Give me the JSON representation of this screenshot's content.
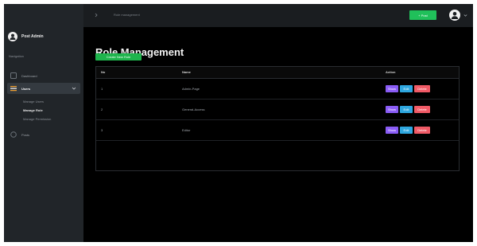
{
  "sidebar": {
    "brand_name": "Post Admin",
    "section_label": "Navigation",
    "items": [
      {
        "label": "Dashboard",
        "icon": "dashboard-icon"
      },
      {
        "label": "Users",
        "icon": "users-icon",
        "active": true
      },
      {
        "label": "Posts",
        "icon": "posts-icon"
      }
    ],
    "sub_items": [
      {
        "label": "Manage Users"
      },
      {
        "label": "Manage Role",
        "current": true
      },
      {
        "label": "Manage Permission"
      }
    ]
  },
  "topbar": {
    "breadcrumb": "Role management",
    "new_button": "+ Post"
  },
  "main": {
    "title": "Role Management",
    "create_button": "Create New Role",
    "table": {
      "headers": [
        "No",
        "Name",
        "Action"
      ],
      "rows": [
        {
          "no": "1",
          "name": "Admin-Page",
          "actions": [
            "Show",
            "Edit",
            "Delete"
          ]
        },
        {
          "no": "2",
          "name": "General-Access",
          "actions": [
            "Show",
            "Edit",
            "Delete"
          ]
        },
        {
          "no": "3",
          "name": "Editor",
          "actions": [
            "Show",
            "Edit",
            "Delete"
          ]
        }
      ]
    }
  },
  "colors": {
    "sidebar_bg": "#212529",
    "main_bg": "#000000",
    "primary_green": "#1fb44d",
    "show": "#8a5cf6",
    "edit": "#2ea7e0",
    "delete": "#f05a66"
  }
}
